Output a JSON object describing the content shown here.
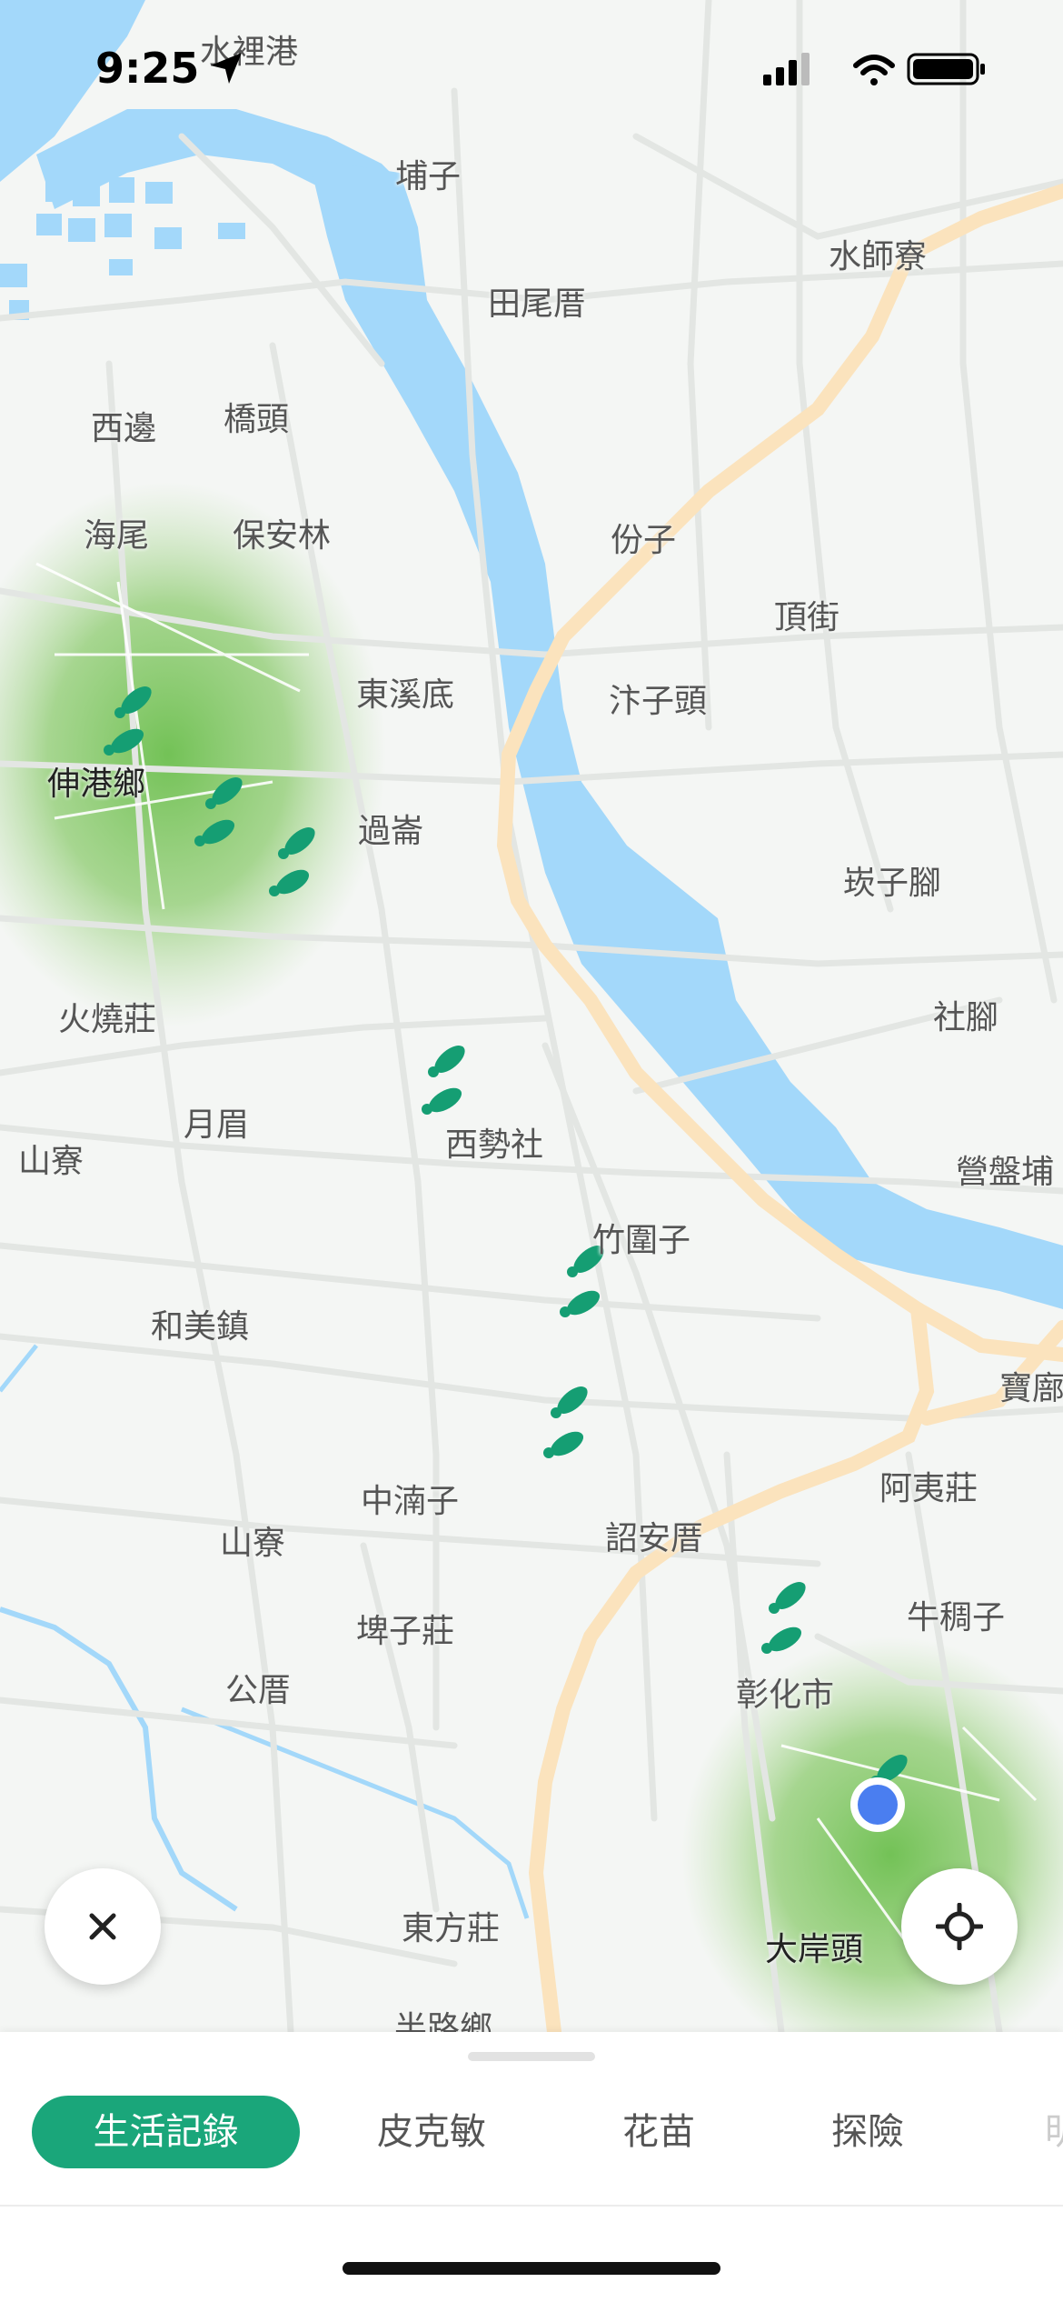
{
  "status_bar": {
    "time": "9:25",
    "icons": [
      "location-arrow-icon",
      "cellular-signal-icon",
      "wifi-icon",
      "battery-icon"
    ]
  },
  "map": {
    "colors": {
      "land": "#f4f6f4",
      "road": "#e6e8e6",
      "water": "#a3d8fa",
      "highway": "#fbe3bd",
      "visited_area": "#8ccb6e",
      "footprint": "#159e73",
      "user_location": "#4a7ef0"
    },
    "places": [
      {
        "id": "shuiligang",
        "label": "水裡港",
        "major": false
      },
      {
        "id": "buzi",
        "label": "埔子",
        "major": false
      },
      {
        "id": "tianweicuo",
        "label": "田尾厝",
        "major": false
      },
      {
        "id": "shuishiliao",
        "label": "水師寮",
        "major": false
      },
      {
        "id": "xibian",
        "label": "西邊",
        "major": false
      },
      {
        "id": "qiaotou",
        "label": "橋頭",
        "major": false
      },
      {
        "id": "haiwei",
        "label": "海尾",
        "major": false
      },
      {
        "id": "baoanlin",
        "label": "保安林",
        "major": false
      },
      {
        "id": "fenzi",
        "label": "份子",
        "major": false
      },
      {
        "id": "dingjie",
        "label": "頂街",
        "major": false
      },
      {
        "id": "dongxidi",
        "label": "東溪底",
        "major": false
      },
      {
        "id": "zhizitou",
        "label": "汴子頭",
        "major": false
      },
      {
        "id": "shengangxiang",
        "label": "伸港鄉",
        "major": true
      },
      {
        "id": "guoluan",
        "label": "過崙",
        "major": false
      },
      {
        "id": "tanzijiao",
        "label": "崁子腳",
        "major": false
      },
      {
        "id": "shejiao",
        "label": "社腳",
        "major": false
      },
      {
        "id": "huoshaozhuang",
        "label": "火燒莊",
        "major": false
      },
      {
        "id": "yuemei",
        "label": "月眉",
        "major": false
      },
      {
        "id": "xishishe",
        "label": "西勢社",
        "major": false
      },
      {
        "id": "shanliao1",
        "label": "山寮",
        "major": false
      },
      {
        "id": "yingpanpu",
        "label": "營盤埔",
        "major": false
      },
      {
        "id": "zhuweizi",
        "label": "竹圍子",
        "major": false
      },
      {
        "id": "hemeizhen",
        "label": "和美鎮",
        "major": false
      },
      {
        "id": "baoliao",
        "label": "寶廍",
        "major": false
      },
      {
        "id": "ayizhuang",
        "label": "阿夷莊",
        "major": false
      },
      {
        "id": "zhongnanzi",
        "label": "中湳子",
        "major": false
      },
      {
        "id": "shaoancuo",
        "label": "詔安厝",
        "major": false
      },
      {
        "id": "shanliao2",
        "label": "山寮",
        "major": false
      },
      {
        "id": "niuchouzi",
        "label": "牛稠子",
        "major": false
      },
      {
        "id": "bizizhuang",
        "label": "埤子莊",
        "major": false
      },
      {
        "id": "gongcuo",
        "label": "公厝",
        "major": false
      },
      {
        "id": "changhuashi",
        "label": "彰化市",
        "major": false
      },
      {
        "id": "dongfangzhuang",
        "label": "東方莊",
        "major": false
      },
      {
        "id": "dongantou",
        "label": "大岸頭",
        "major": true
      },
      {
        "id": "banluxiang",
        "label": "半路鄉",
        "major": false
      }
    ]
  },
  "controls": {
    "close_icon": "close-icon",
    "recenter_icon": "crosshair-icon"
  },
  "bottom_sheet": {
    "tabs": [
      {
        "label": "生活記錄",
        "active": true
      },
      {
        "label": "皮克敏",
        "active": false
      },
      {
        "label": "花苗",
        "active": false
      },
      {
        "label": "探險",
        "active": false
      },
      {
        "label": "明",
        "active": false
      }
    ]
  }
}
